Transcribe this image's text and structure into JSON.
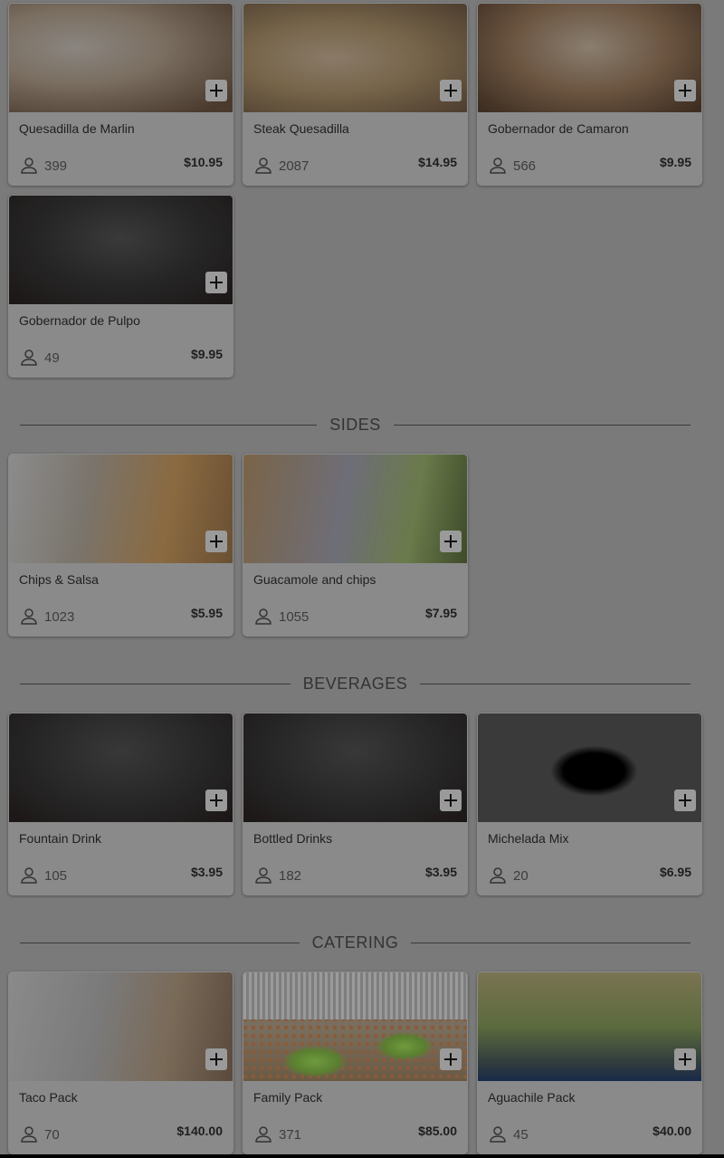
{
  "sections": [
    {
      "title": "",
      "items": [
        {
          "name": "Quesadilla de Marlin",
          "count": "399",
          "price": "$10.95",
          "image": "quesadilla-marlin"
        },
        {
          "name": "Steak Quesadilla",
          "count": "2087",
          "price": "$14.95",
          "image": "steak-quesadilla"
        },
        {
          "name": "Gobernador de Camaron",
          "count": "566",
          "price": "$9.95",
          "image": "gobernador-camaron"
        },
        {
          "name": "Gobernador de Pulpo",
          "count": "49",
          "price": "$9.95",
          "image": "gobernador-pulpo"
        }
      ]
    },
    {
      "title": "SIDES",
      "items": [
        {
          "name": "Chips & Salsa",
          "count": "1023",
          "price": "$5.95",
          "image": "chips-salsa"
        },
        {
          "name": "Guacamole and chips",
          "count": "1055",
          "price": "$7.95",
          "image": "guacamole-chips"
        }
      ]
    },
    {
      "title": "BEVERAGES",
      "items": [
        {
          "name": "Fountain Drink",
          "count": "105",
          "price": "$3.95",
          "image": "fountain-drink"
        },
        {
          "name": "Bottled Drinks",
          "count": "182",
          "price": "$3.95",
          "image": "bottled-drinks"
        },
        {
          "name": "Michelada Mix",
          "count": "20",
          "price": "$6.95",
          "image": "michelada-mix"
        }
      ]
    },
    {
      "title": "CATERING",
      "items": [
        {
          "name": "Taco Pack",
          "count": "70",
          "price": "$140.00",
          "image": "taco-pack"
        },
        {
          "name": "Family Pack",
          "count": "371",
          "price": "$85.00",
          "image": "family-pack"
        },
        {
          "name": "Aguachile Pack",
          "count": "45",
          "price": "$40.00",
          "image": "aguachile-pack"
        }
      ]
    }
  ],
  "icons": {
    "add": "plus-icon",
    "count": "person-icon"
  },
  "colors": {
    "overlay": "#7a7a7a",
    "card": "#8a8a8a",
    "text": "#1e1e1e"
  }
}
